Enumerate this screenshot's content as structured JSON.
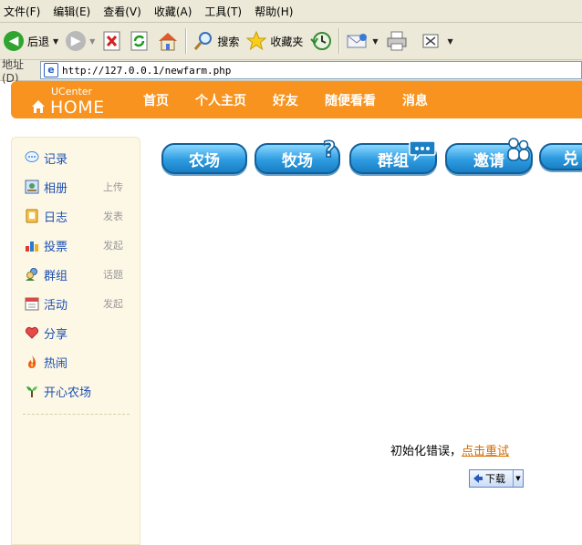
{
  "menubar": {
    "items": [
      "文件(F)",
      "编辑(E)",
      "查看(V)",
      "收藏(A)",
      "工具(T)",
      "帮助(H)"
    ]
  },
  "toolbar": {
    "back_label": "后退",
    "search_label": "搜索",
    "favorites_label": "收藏夹"
  },
  "addressbar": {
    "label": "地址(D)",
    "url": "http://127.0.0.1/newfarm.php"
  },
  "header": {
    "logo_top": "UCenter",
    "logo_bottom": "HOME",
    "nav": [
      "首页",
      "个人主页",
      "好友",
      "随便看看",
      "消息"
    ]
  },
  "sidebar": {
    "items": [
      {
        "label": "记录",
        "sub": "",
        "icon": "speech-bubble-icon"
      },
      {
        "label": "相册",
        "sub": "上传",
        "icon": "photo-icon"
      },
      {
        "label": "日志",
        "sub": "发表",
        "icon": "notebook-icon"
      },
      {
        "label": "投票",
        "sub": "发起",
        "icon": "bar-chart-icon"
      },
      {
        "label": "群组",
        "sub": "话题",
        "icon": "group-icon"
      },
      {
        "label": "活动",
        "sub": "发起",
        "icon": "calendar-icon"
      },
      {
        "label": "分享",
        "sub": "",
        "icon": "heart-icon"
      },
      {
        "label": "热闹",
        "sub": "",
        "icon": "flame-icon"
      },
      {
        "label": "开心农场",
        "sub": "",
        "icon": "sprout-icon"
      }
    ]
  },
  "game": {
    "buttons": [
      "农场",
      "牧场",
      "群组",
      "邀请",
      "兑"
    ],
    "error_text": "初始化错误，",
    "retry_link": "点击重试"
  },
  "download": {
    "label": "下载"
  },
  "colors": {
    "header_orange": "#f7931e",
    "sidebar_bg": "#fdf8e6",
    "link_blue": "#1c4fb3",
    "retry_orange": "#d46b00",
    "button_blue": "#2d9be0"
  }
}
